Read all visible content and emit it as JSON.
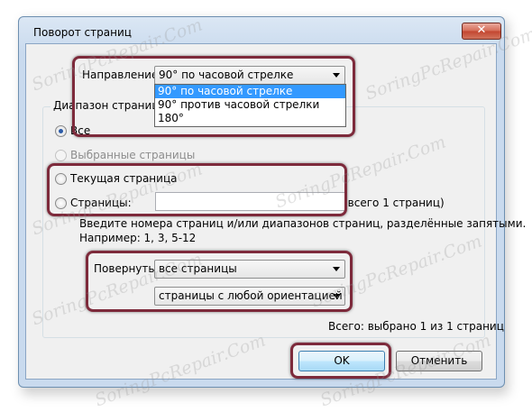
{
  "window": {
    "title": "Поворот страниц",
    "close_glyph": "✕"
  },
  "direction": {
    "label": "Направление:",
    "selected": "90° по часовой стрелке",
    "options": [
      "90° по часовой стрелке",
      "90° против часовой стрелки",
      "180°"
    ]
  },
  "page_range": {
    "group_title": "Диапазон страниц",
    "all_label": "Все",
    "selected_pages_label": "Выбранные страницы",
    "current_page_label": "Текущая страница",
    "pages_label": "Страницы:",
    "pages_value": "",
    "total_pages_note": "(всего 1 страниц)",
    "hint_line1": "Введите номера страниц и/или диапазонов страниц, разделённые запятыми.",
    "hint_line2": "Например: 1, 3, 5-12"
  },
  "rotate": {
    "label": "Повернуть:",
    "pages_filter": "все страницы",
    "orientation_filter": "страницы с любой ориентацией"
  },
  "summary": "Всего: выбрано 1 из 1 страниц",
  "buttons": {
    "ok": "OK",
    "cancel": "Отменить"
  },
  "watermark_text": "SoringPcRepair.Com",
  "colors": {
    "highlight": "#7d2a3b",
    "selection": "#3399ff",
    "title_bar": "#c9daee"
  }
}
